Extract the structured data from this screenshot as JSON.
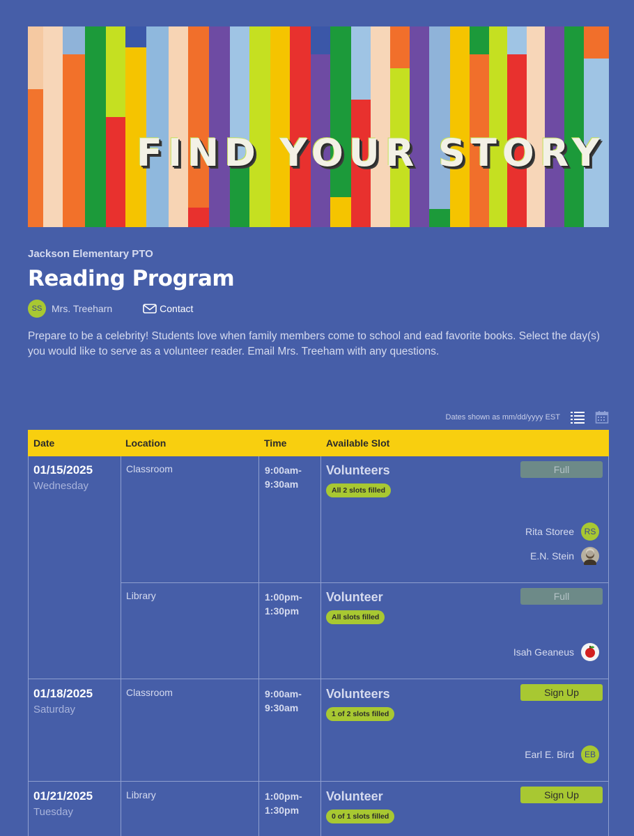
{
  "banner": {
    "text": "FIND YOUR STORY"
  },
  "header": {
    "org": "Jackson Elementary PTO",
    "title": "Reading Program",
    "owner_initials": "SS",
    "owner_name": "Mrs. Treeharn",
    "contact_label": "Contact",
    "description": "Prepare to be a celebrity! Students love when family members come to school and ead favorite books. Select the day(s) you would like to serve as a volunteer reader. Email Mrs. Treeham with any questions."
  },
  "tools": {
    "dates_note": "Dates shown as mm/dd/yyyy EST",
    "list_view": "list-view-icon",
    "calendar_view": "calendar-view-icon"
  },
  "table": {
    "columns": [
      "Date",
      "Location",
      "Time",
      "Available Slot"
    ],
    "dates": [
      {
        "date": "01/15/2025",
        "day": "Wednesday"
      },
      {
        "date": "01/18/2025",
        "day": "Saturday"
      },
      {
        "date": "01/21/2025",
        "day": "Tuesday"
      }
    ],
    "rows": [
      {
        "location": "Classroom",
        "time": "9:00am-\n9:30am",
        "slot": "Volunteers",
        "status": "All 2 slots filled",
        "button": "Full",
        "volunteers": [
          {
            "name": "Rita Storee",
            "initials": "RS"
          },
          {
            "name": "E.N. Stein",
            "initials": ""
          }
        ]
      },
      {
        "location": "Library",
        "time": "1:00pm-\n1:30pm",
        "slot": "Volunteer",
        "status": "All slots filled",
        "button": "Full",
        "volunteers": [
          {
            "name": "Isah Geaneus",
            "initials": ""
          }
        ]
      },
      {
        "location": "Classroom",
        "time": "9:00am-\n9:30am",
        "slot": "Volunteers",
        "status": "1 of 2 slots filled",
        "button": "Sign Up",
        "volunteers": [
          {
            "name": "Earl E. Bird",
            "initials": "EB"
          }
        ]
      },
      {
        "location": "Library",
        "time": "1:00pm-\n1:30pm",
        "slot": "Volunteer",
        "status": "0 of 1 slots filled",
        "button": "Sign Up",
        "volunteers": []
      }
    ]
  },
  "colors": {
    "background": "#465ea8",
    "header_row": "#f8cf0f",
    "accent_green": "#a8c832",
    "full_button": "#6d8a88"
  }
}
